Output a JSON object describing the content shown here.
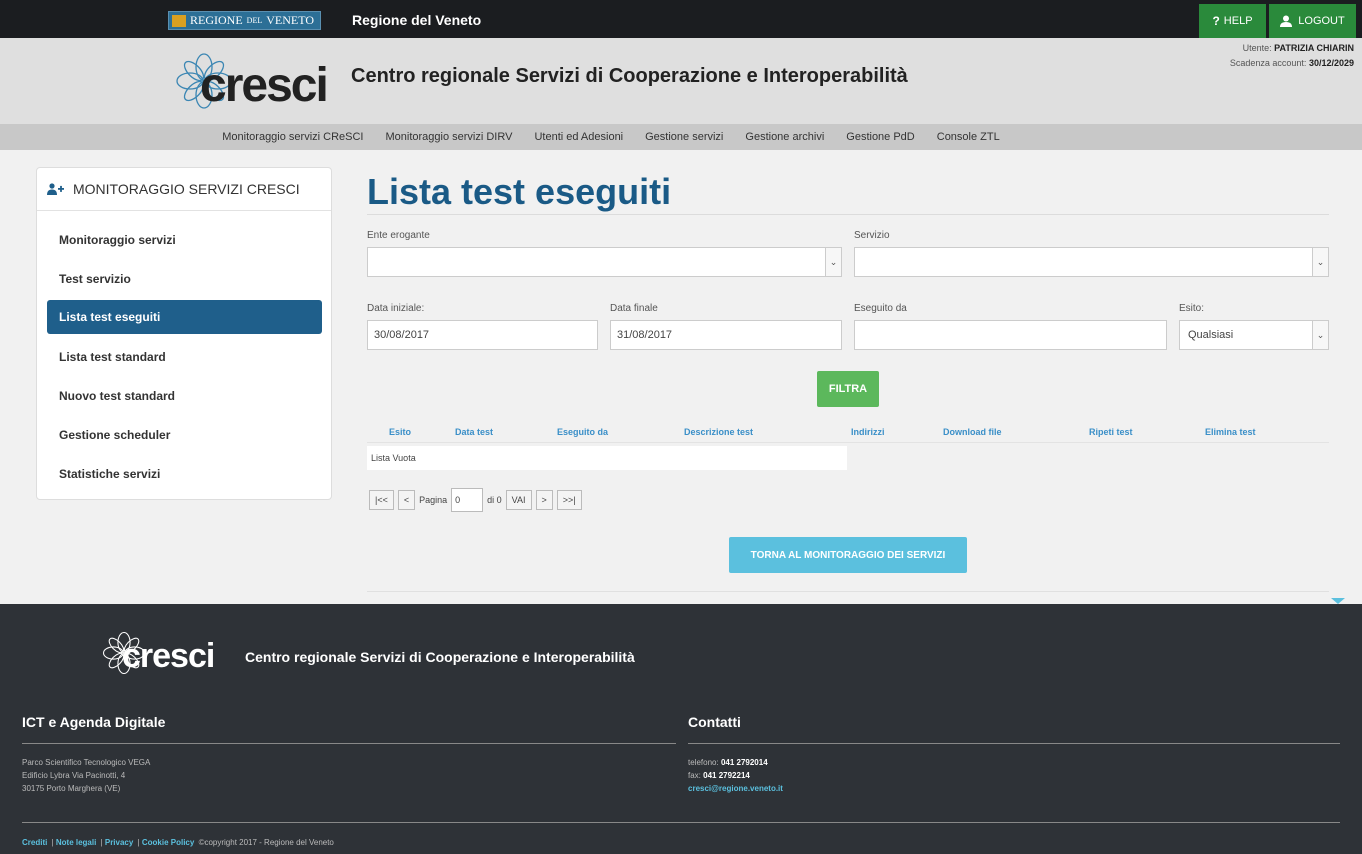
{
  "topbar": {
    "region_badge": "REGIONE",
    "region_badge_small": "DEL",
    "region_badge_end": "VENETO",
    "title": "Regione del Veneto",
    "help_label": "HELP",
    "logout_label": "LOGOUT"
  },
  "header": {
    "logo_text": "cresci",
    "title": "Centro regionale Servizi di Cooperazione e Interoperabilità",
    "user_label": "Utente:",
    "user_name": "PATRIZIA CHIARIN",
    "expiry_label": "Scadenza account:",
    "expiry_date": "30/12/2029"
  },
  "nav": {
    "items": [
      "Monitoraggio servizi CReSCI",
      "Monitoraggio servizi DIRV",
      "Utenti ed Adesioni",
      "Gestione servizi",
      "Gestione archivi",
      "Gestione PdD",
      "Console ZTL"
    ]
  },
  "sidebar": {
    "title": "MONITORAGGIO SERVIZI CRESCI",
    "items": [
      "Monitoraggio servizi",
      "Test servizio",
      "Lista test eseguiti",
      "Lista test standard",
      "Nuovo test standard",
      "Gestione scheduler",
      "Statistiche servizi"
    ],
    "active_index": 2
  },
  "main": {
    "title": "Lista test eseguiti",
    "ente_label": "Ente erogante",
    "ente_value": "",
    "servizio_label": "Servizio",
    "servizio_value": "",
    "data_iniziale_label": "Data iniziale:",
    "data_iniziale_value": "30/08/2017",
    "data_finale_label": "Data finale",
    "data_finale_value": "31/08/2017",
    "eseguito_da_label": "Eseguito da",
    "eseguito_da_value": "",
    "esito_label": "Esito:",
    "esito_value": "Qualsiasi",
    "filtra_label": "FILTRA",
    "table_headers": [
      "Esito",
      "Data test",
      "Eseguito da",
      "Descrizione test",
      "Indirizzi",
      "Download file",
      "Ripeti test",
      "Elimina test"
    ],
    "empty_text": "Lista Vuota",
    "pager": {
      "first": "|<<",
      "prev": "<",
      "page_label": "Pagina",
      "page_value": "0",
      "of_label": "di 0",
      "go": "VAI",
      "next": ">",
      "last": ">>|"
    },
    "back_label": "TORNA AL MONITORAGGIO DEI SERVIZI"
  },
  "footer": {
    "logo_text": "cresci",
    "title": "Centro regionale Servizi di Cooperazione e Interoperabilità",
    "left_heading": "ICT e Agenda Digitale",
    "address": [
      "Parco Scientifico Tecnologico VEGA",
      "Edificio Lybra Via Pacinotti, 4",
      "30175 Porto Marghera (VE)"
    ],
    "right_heading": "Contatti",
    "phone_label": "telefono:",
    "phone": "041 2792014",
    "fax_label": "fax:",
    "fax": "041 2792214",
    "email": "cresci@regione.veneto.it",
    "links": [
      "Crediti",
      "Note legali",
      "Privacy",
      "Cookie Policy"
    ],
    "copyright": "©copyright 2017 - Regione del Veneto"
  },
  "colors": {
    "accent_blue": "#1a5a86",
    "active_item": "#1f5f8b",
    "green": "#5cb85c",
    "light_blue": "#5bc0de",
    "topbar": "#1b1d20",
    "footer": "#2e3237"
  }
}
